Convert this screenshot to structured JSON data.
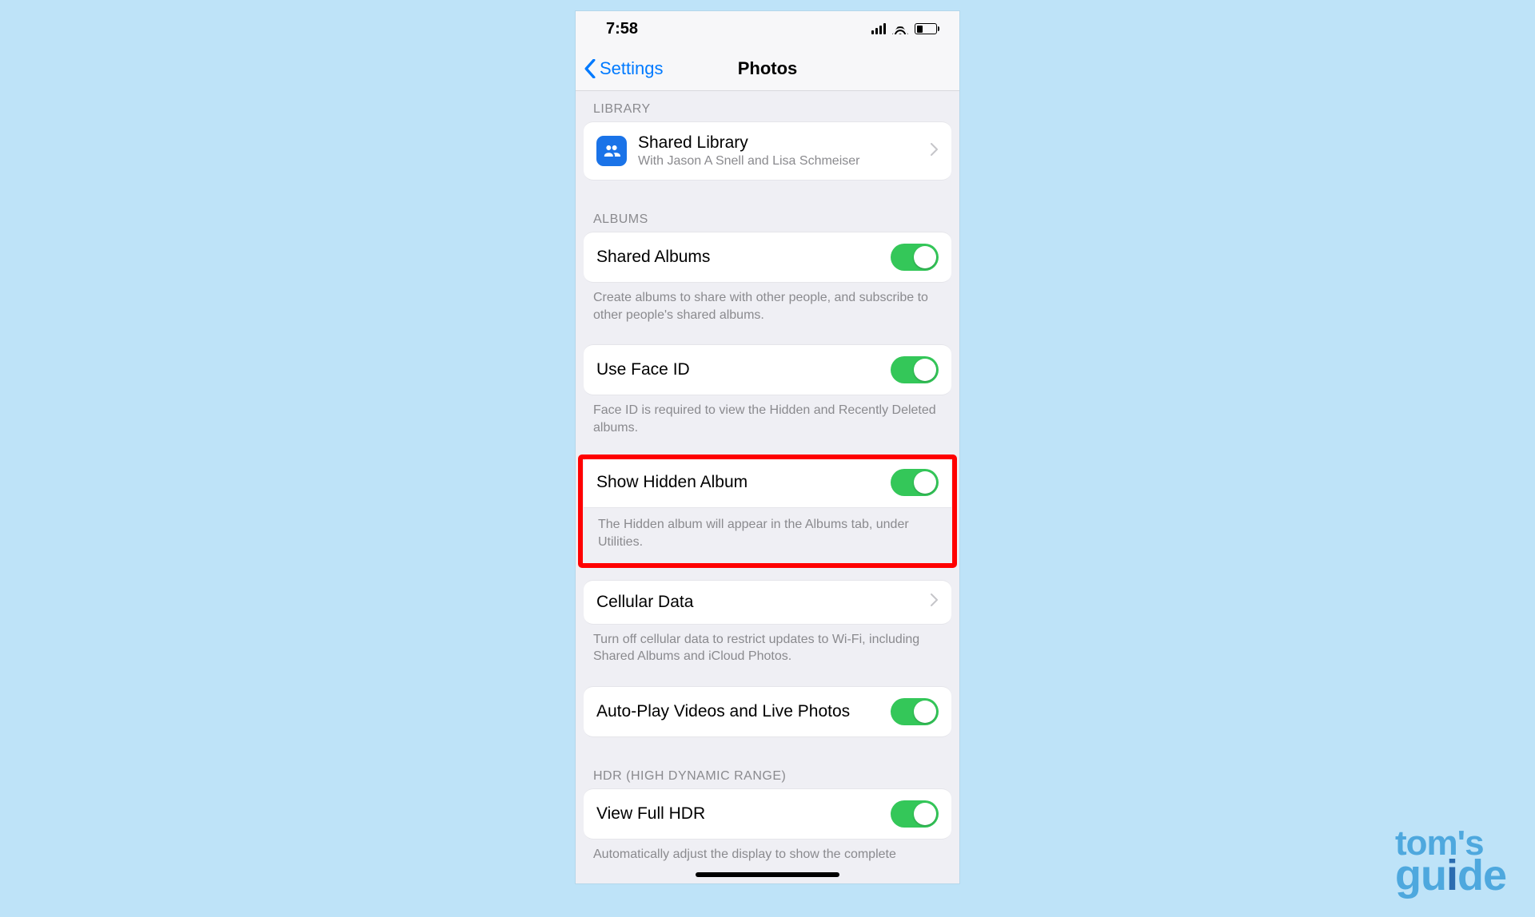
{
  "watermark": {
    "line1": "tom's",
    "line2_a": "gu",
    "line2_b": "i",
    "line2_c": "de"
  },
  "status": {
    "time": "7:58"
  },
  "nav": {
    "back": "Settings",
    "title": "Photos"
  },
  "groups": {
    "library": {
      "header": "LIBRARY",
      "shared_library": {
        "title": "Shared Library",
        "subtitle": "With Jason A Snell and Lisa Schmeiser"
      }
    },
    "albums": {
      "header": "ALBUMS",
      "shared_albums": {
        "title": "Shared Albums",
        "on": true,
        "footer": "Create albums to share with other people, and subscribe to other people's shared albums."
      },
      "faceid": {
        "title": "Use Face ID",
        "on": true,
        "footer": "Face ID is required to view the Hidden and Recently Deleted albums."
      },
      "hidden": {
        "title": "Show Hidden Album",
        "on": true,
        "footer": "The Hidden album will appear in the Albums tab, under Utilities."
      },
      "cellular": {
        "title": "Cellular Data",
        "footer": "Turn off cellular data to restrict updates to Wi-Fi, including Shared Albums and iCloud Photos."
      },
      "autoplay": {
        "title": "Auto-Play Videos and Live Photos",
        "on": true
      }
    },
    "hdr": {
      "header": "HDR (HIGH DYNAMIC RANGE)",
      "viewfull": {
        "title": "View Full HDR",
        "on": true
      },
      "footer_partial": "Automatically adjust the display to show the complete"
    }
  }
}
